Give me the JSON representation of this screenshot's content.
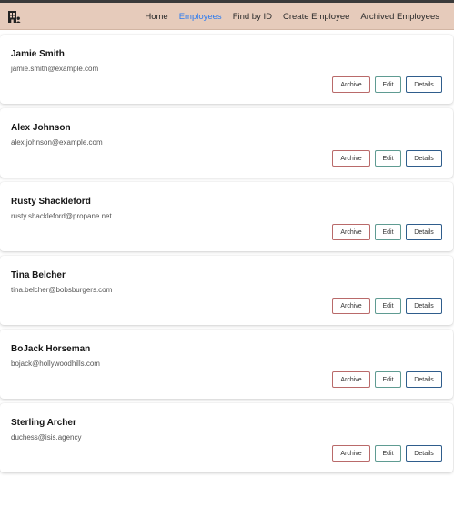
{
  "nav": {
    "logo_icon": "building-icon",
    "links": [
      {
        "label": "Home",
        "active": false
      },
      {
        "label": "Employees",
        "active": true
      },
      {
        "label": "Find by ID",
        "active": false
      },
      {
        "label": "Create Employee",
        "active": false
      },
      {
        "label": "Archived Employees",
        "active": false
      }
    ]
  },
  "colors": {
    "navbar_bg": "#e6cbbb",
    "active_link": "#2d7bf0",
    "archive_border": "#b96a6a",
    "edit_border": "#5f9b92",
    "details_border": "#2f5d8c"
  },
  "buttons": {
    "archive": "Archive",
    "edit": "Edit",
    "details": "Details"
  },
  "employees": [
    {
      "name": "Jamie Smith",
      "email": "jamie.smith@example.com"
    },
    {
      "name": "Alex Johnson",
      "email": "alex.johnson@example.com"
    },
    {
      "name": "Rusty Shackleford",
      "email": "rusty.shackleford@propane.net"
    },
    {
      "name": "Tina Belcher",
      "email": "tina.belcher@bobsburgers.com"
    },
    {
      "name": "BoJack Horseman",
      "email": "bojack@hollywoodhills.com"
    },
    {
      "name": "Sterling Archer",
      "email": "duchess@isis.agency"
    }
  ]
}
